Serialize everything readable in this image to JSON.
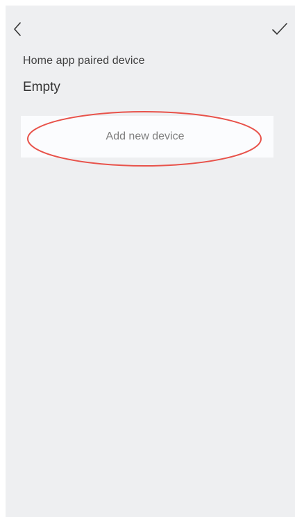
{
  "nav": {
    "back_icon": "chevron-left-icon",
    "confirm_icon": "checkmark-icon"
  },
  "paired_section": {
    "label": "Home app paired device",
    "value": "Empty"
  },
  "add_device": {
    "label": "Add new device"
  },
  "colors": {
    "background": "#eeeff1",
    "card": "#fbfcfe",
    "annotation": "#e8524a"
  }
}
